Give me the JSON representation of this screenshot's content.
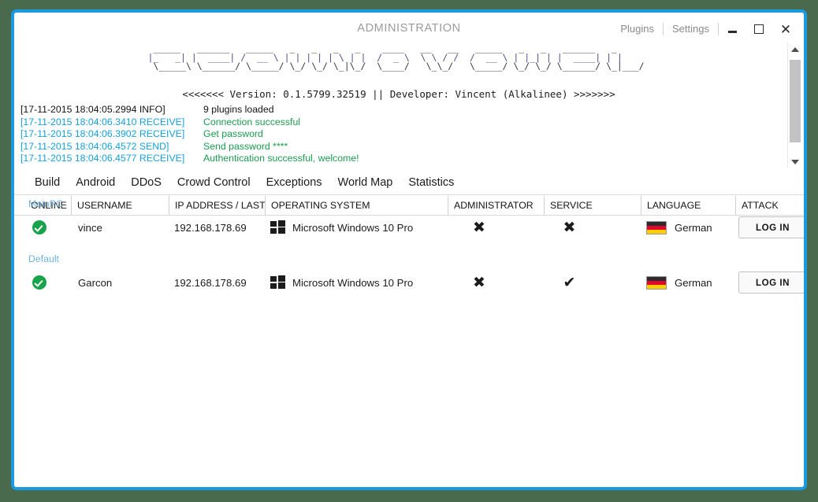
{
  "window": {
    "title": "ADMINISTRATION",
    "border_color": "#1a9ae0",
    "desktop_color": "#4a6a4d"
  },
  "titlebar": {
    "links": [
      "Plugins",
      "Settings"
    ],
    "minimize_label": "Minimize",
    "maximize_label": "Maximize",
    "close_label": "✕"
  },
  "banner": {
    "ascii_line1": "  _____   ______   _____   _   _   _   _    ____   __   __   _____   _   _   ______   _       ",
    "ascii_line2": " |_   _| |  ____| /  __ \\ | | | | | \\ | |  /  _ \\  \\ \\ / /  /  __ \\ | |_| | |  ____| | |      ",
    "ascii_line3": " \\_____\\ \\______/ \\_____/ \\_/ \\_/ \\_|\\_/  \\____/   \\_\\_/   \\_____/ \\_/ \\_/ \\______/ \\_|___/ ",
    "version_line": "<<<<<<< Version: 0.1.5799.32519 || Developer: Vincent (Alkalinee) >>>>>>>"
  },
  "log": {
    "entries": [
      {
        "timestamp": "[17-11-2015 18:04:05.2994 INFO]",
        "message": "9 plugins loaded",
        "level": "info"
      },
      {
        "timestamp": "[17-11-2015 18:04:06.3410 RECEIVE]",
        "message": "Connection successful",
        "level": "recv"
      },
      {
        "timestamp": "[17-11-2015 18:04:06.3902 RECEIVE]",
        "message": "Get password",
        "level": "recv"
      },
      {
        "timestamp": "[17-11-2015 18:04:06.4572 SEND]",
        "message": "Send password ****",
        "level": "send"
      },
      {
        "timestamp": "[17-11-2015 18:04:06.4577 RECEIVE]",
        "message": "Authentication successful, welcome!",
        "level": "recv"
      }
    ]
  },
  "tabs": [
    {
      "label": "Build"
    },
    {
      "label": "Android"
    },
    {
      "label": "DDoS"
    },
    {
      "label": "Crowd Control"
    },
    {
      "label": "Exceptions"
    },
    {
      "label": "World Map"
    },
    {
      "label": "Statistics"
    }
  ],
  "grid": {
    "columns": [
      {
        "label": "ONLINE"
      },
      {
        "label": "USERNAME"
      },
      {
        "label": "IP ADDRESS / LAST S"
      },
      {
        "label": "OPERATING SYSTEM"
      },
      {
        "label": "ADMINISTRATOR"
      },
      {
        "label": "SERVICE"
      },
      {
        "label": "LANGUAGE"
      },
      {
        "label": "ATTACK"
      }
    ],
    "groups": [
      {
        "label": "MainPC",
        "rows": [
          {
            "online": "online-check-icon",
            "username": "vince",
            "ip": "192.168.178.69",
            "os_icon": "windows-logo-icon",
            "os": "Microsoft Windows 10 Pro",
            "administrator": "✖",
            "service": "✖",
            "flag": "german-flag-icon",
            "language": "German",
            "attack_label": "LOG IN"
          }
        ]
      },
      {
        "label": "Default",
        "rows": [
          {
            "online": "online-check-icon",
            "username": "Garcon",
            "ip": "192.168.178.69",
            "os_icon": "windows-logo-icon",
            "os": "Microsoft Windows 10 Pro",
            "administrator": "✖",
            "service": "✔",
            "flag": "german-flag-icon",
            "language": "German",
            "attack_label": "LOG IN"
          }
        ]
      }
    ]
  }
}
